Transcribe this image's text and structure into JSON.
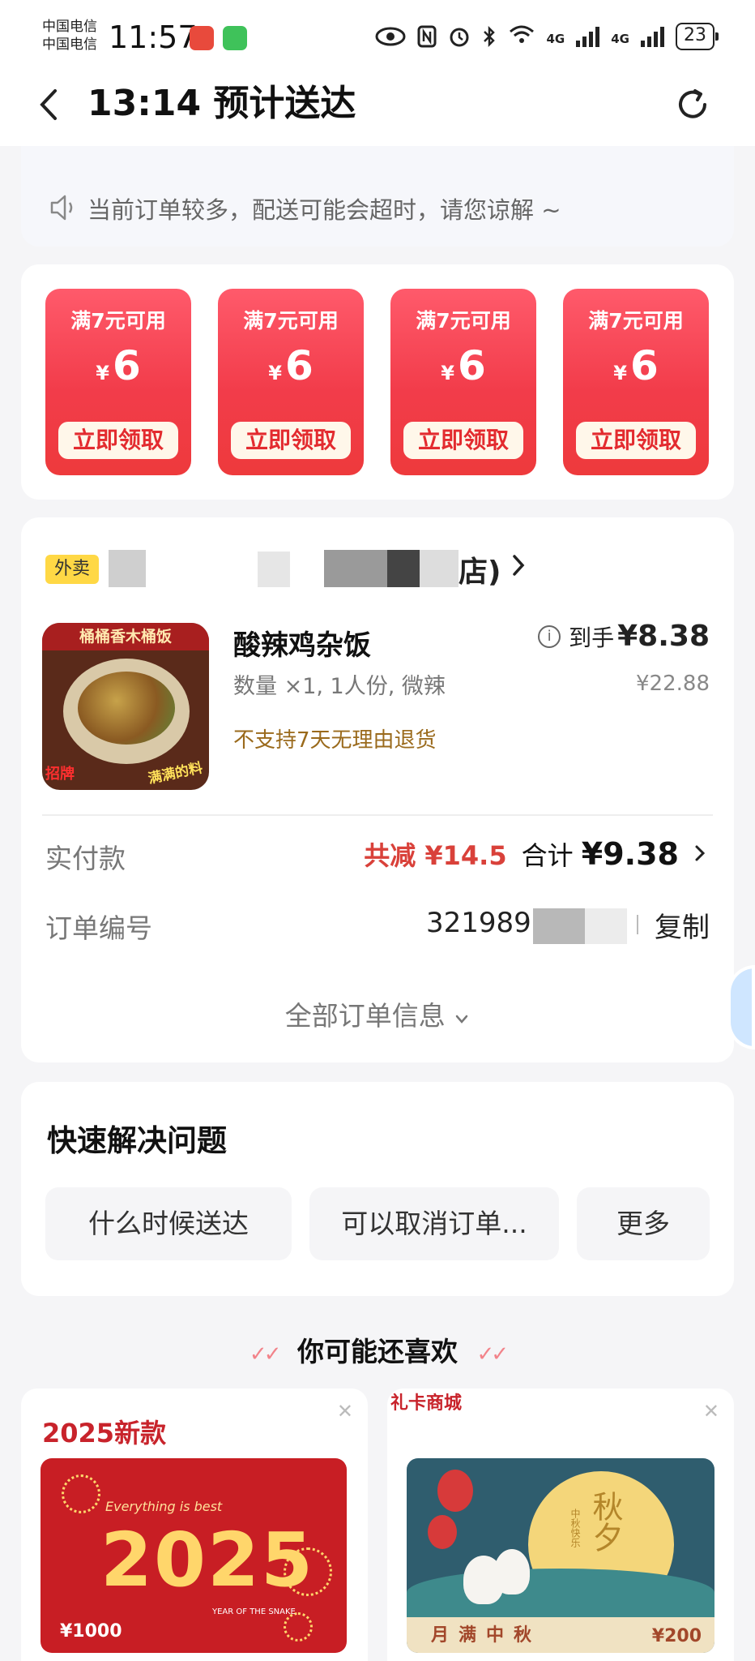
{
  "status_bar": {
    "carrier_1": "中国电信",
    "carrier_2": "中国电信",
    "time": "11:57",
    "network_1": "4G",
    "network_2": "4G",
    "wifi_label": "6",
    "battery": "23"
  },
  "header": {
    "title": "13:14 预计送达",
    "back_icon": "chevron-left-icon",
    "refresh_icon": "refresh-icon"
  },
  "notice": {
    "text": "当前订单较多，配送可能会超时，请您谅解 ~"
  },
  "coupons": [
    {
      "condition": "满7元可用",
      "currency": "¥",
      "amount": "6",
      "action": "立即领取"
    },
    {
      "condition": "满7元可用",
      "currency": "¥",
      "amount": "6",
      "action": "立即领取"
    },
    {
      "condition": "满7元可用",
      "currency": "¥",
      "amount": "6",
      "action": "立即领取"
    },
    {
      "condition": "满7元可用",
      "currency": "¥",
      "amount": "6",
      "action": "立即领取"
    }
  ],
  "order": {
    "tag": "外卖",
    "shop_name_tail": "店)",
    "item": {
      "image_banner": "桶桶香木桶饭",
      "image_badge_left": "招牌",
      "image_badge_right": "满满的料",
      "name": "酸辣鸡杂饭",
      "spec": "数量 ×1, 1人份, 微辣",
      "policy": "不支持7天无理由退货",
      "received_label": "到手",
      "received_price": "¥8.38",
      "original_price": "¥22.88"
    },
    "paid_label": "实付款",
    "discount": "共减 ¥14.5",
    "total_label": "合计",
    "total_value": "¥9.38",
    "order_no_label": "订单编号",
    "order_no_visible": "3219895",
    "copy_label": "复制",
    "all_info": "全部订单信息"
  },
  "quick": {
    "title": "快速解决问题",
    "buttons": [
      "什么时候送达",
      "可以取消订单...",
      "更多"
    ]
  },
  "recommend": {
    "title": "你可能还喜欢",
    "cards": [
      {
        "heading": "2025新款",
        "slogan": "Everything is best",
        "year": "2025",
        "subtitle": "YEAR OF THE SNAKE",
        "price": "¥1000"
      },
      {
        "brand": "礼卡商城",
        "title": "秋夕",
        "subtitle": "中秋快乐",
        "slogan": "月满中秋",
        "price": "¥200"
      }
    ]
  },
  "colors": {
    "accent_red": "#ee3a3c",
    "discount_red": "#d9413a",
    "tag_yellow": "#ffd845",
    "policy_brown": "#9a6a1c"
  }
}
